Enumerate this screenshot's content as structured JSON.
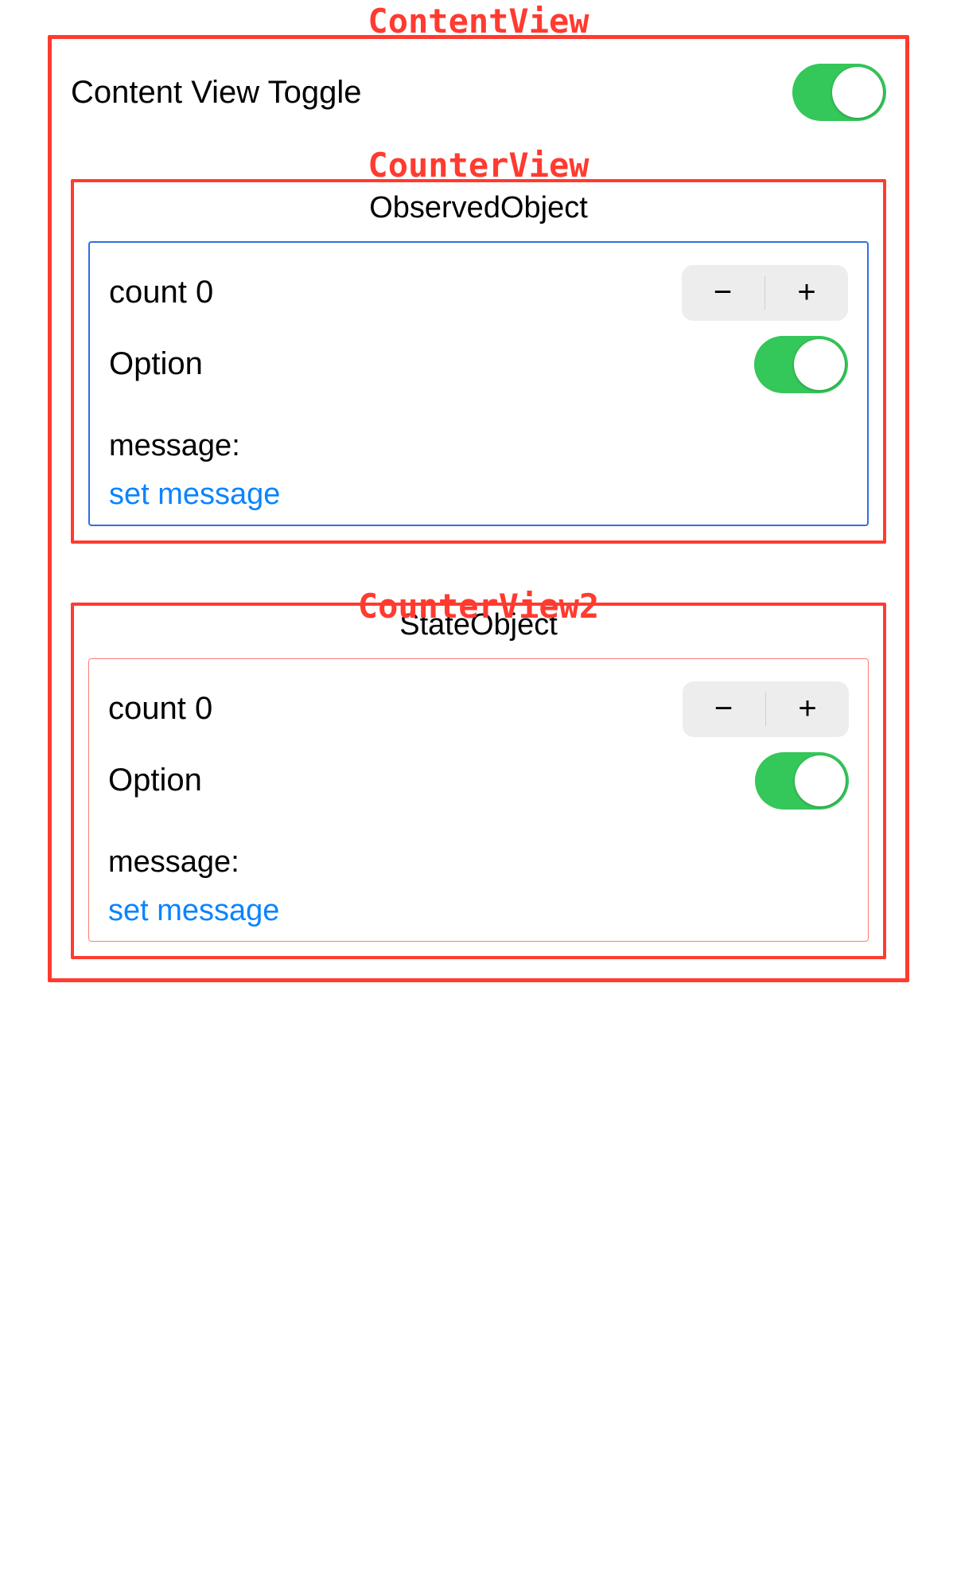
{
  "annotations": {
    "content_view": "ContentView",
    "counter_view": "CounterView",
    "counter_view2": "CounterView2"
  },
  "content_view": {
    "toggle_label": "Content View Toggle",
    "toggle_on": true
  },
  "counter_view": {
    "title": "ObservedObject",
    "count_label": "count 0",
    "minus": "−",
    "plus": "+",
    "option_label": "Option",
    "option_on": true,
    "message_label": "message:",
    "set_message": "set message"
  },
  "counter_view2": {
    "title": "StateObject",
    "count_label": "count 0",
    "minus": "−",
    "plus": "+",
    "option_label": "Option",
    "option_on": true,
    "message_label": "message:",
    "set_message": "set message"
  }
}
